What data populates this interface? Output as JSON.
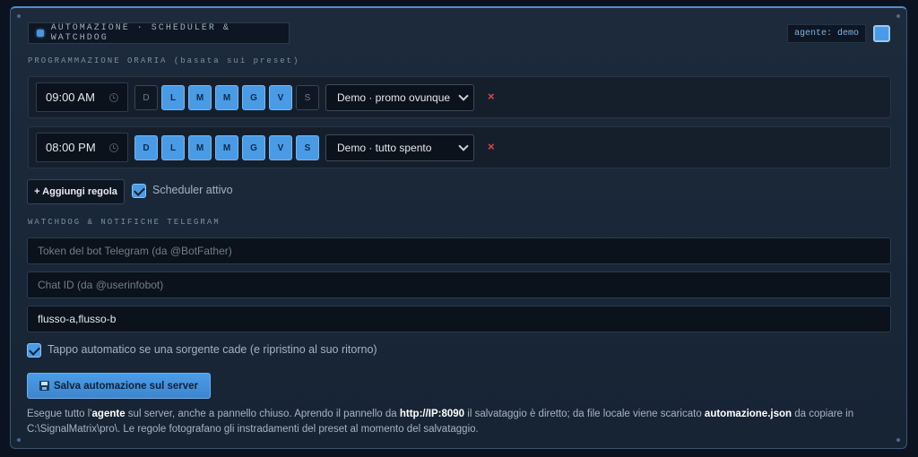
{
  "header": {
    "title": "AUTOMAZIONE · SCHEDULER & WATCHDOG",
    "agent_badge": "agente: demo"
  },
  "schedule": {
    "section_title": "PROGRAMMAZIONE ORARIA (basata sui preset)",
    "rules": [
      {
        "time": "09:00 AM",
        "days": [
          {
            "label": "D",
            "active": false
          },
          {
            "label": "L",
            "active": true
          },
          {
            "label": "M",
            "active": true
          },
          {
            "label": "M",
            "active": true
          },
          {
            "label": "G",
            "active": true
          },
          {
            "label": "V",
            "active": true
          },
          {
            "label": "S",
            "active": false
          }
        ],
        "preset": "Demo · promo ovunque",
        "delete_label": "×"
      },
      {
        "time": "08:00 PM",
        "days": [
          {
            "label": "D",
            "active": true
          },
          {
            "label": "L",
            "active": true
          },
          {
            "label": "M",
            "active": true
          },
          {
            "label": "M",
            "active": true
          },
          {
            "label": "G",
            "active": true
          },
          {
            "label": "V",
            "active": true
          },
          {
            "label": "S",
            "active": true
          }
        ],
        "preset": "Demo · tutto spento",
        "delete_label": "×"
      }
    ],
    "add_rule_label": "+ Aggiungi regola",
    "scheduler_active_label": "Scheduler attivo",
    "scheduler_active": true
  },
  "watchdog": {
    "section_title": "WATCHDOG & NOTIFICHE TELEGRAM",
    "token_placeholder": "Token del bot Telegram (da @BotFather)",
    "chat_id_placeholder": "Chat ID (da @userinfobot)",
    "sources_value": "flusso-a,flusso-b",
    "auto_cap_label": "Tappo automatico se una sorgente cade (e ripristino al suo ritorno)",
    "auto_cap": true
  },
  "save_button_label": "Salva automazione sul server",
  "info": {
    "t1": "Esegue tutto l'",
    "b1": "agente",
    "t2": " sul server, anche a pannello chiuso. Aprendo il pannello da ",
    "b2": "http://IP:8090",
    "t3": " il salvataggio è diretto; da file locale viene scaricato ",
    "b3": "automazione.json",
    "t4": " da copiare in C:\\SignalMatrix\\pro\\. Le regole fotografano gli instradamenti del preset al momento del salvataggio."
  },
  "colors": {
    "accent": "#4a9be6",
    "delete": "#e0454d",
    "background": "#1a2738"
  }
}
